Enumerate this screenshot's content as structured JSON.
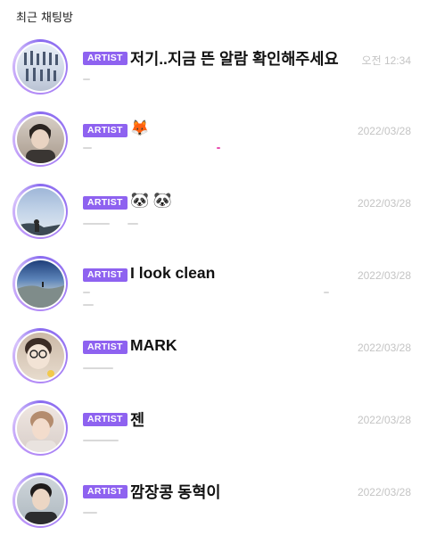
{
  "header": {
    "title": "최근 채팅방"
  },
  "badge_label": "ARTIST",
  "chats": [
    {
      "title": "저기..지금 뜬 알람 확인해주세요",
      "time": "오전 12:34",
      "avatar": "group-photo-icon"
    },
    {
      "title": "🦊",
      "time": "2022/03/28",
      "avatar": "portrait-icon"
    },
    {
      "title": "🐼 🐼",
      "time": "2022/03/28",
      "avatar": "sky-photo-icon"
    },
    {
      "title": "I look clean",
      "time": "2022/03/28",
      "avatar": "landscape-photo-icon"
    },
    {
      "title": "MARK",
      "time": "2022/03/28",
      "avatar": "selfie-icon"
    },
    {
      "title": "젠",
      "time": "2022/03/28",
      "avatar": "portrait-icon"
    },
    {
      "title": "깜장콩 동혁이",
      "time": "2022/03/28",
      "avatar": "portrait-icon"
    }
  ]
}
